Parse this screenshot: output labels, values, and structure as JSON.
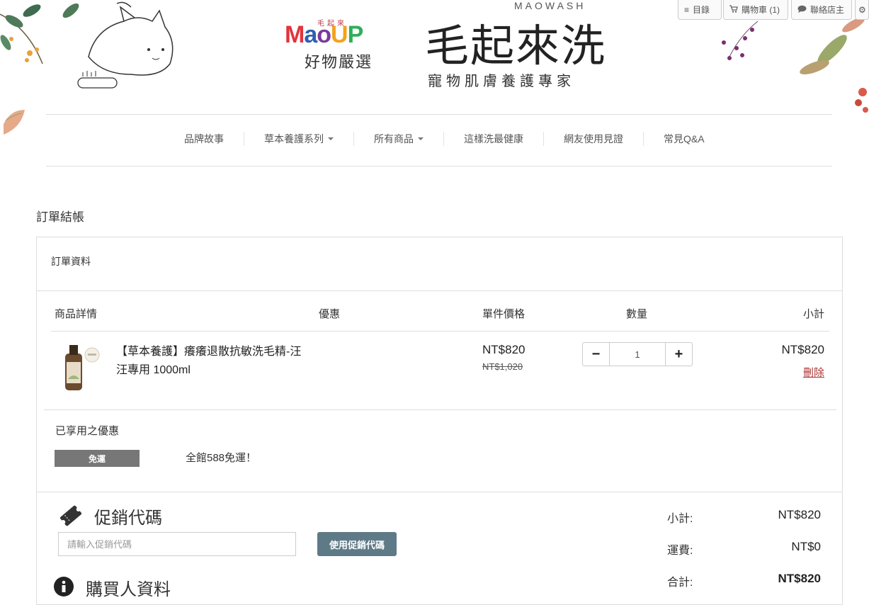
{
  "topbar": {
    "menu_label": "目錄",
    "cart_label": "購物車 (1)",
    "contact_label": "聯絡店主"
  },
  "header": {
    "maoup_small": "毛起來",
    "maoup_letters": [
      "M",
      "a",
      "o",
      "U",
      "P"
    ],
    "haowu": "好物嚴選",
    "brand_en": "MAOWASH",
    "brand_zh": "毛起來洗",
    "brand_sub": "寵物肌膚養護專家"
  },
  "nav": [
    {
      "label": "品牌故事",
      "dropdown": false
    },
    {
      "label": "草本養護系列",
      "dropdown": true
    },
    {
      "label": "所有商品",
      "dropdown": true
    },
    {
      "label": "這樣洗最健康",
      "dropdown": false
    },
    {
      "label": "網友使用見證",
      "dropdown": false
    },
    {
      "label": "常見Q&A",
      "dropdown": false
    }
  ],
  "page_title": "訂單結帳",
  "order": {
    "section_title": "訂單資料",
    "columns": {
      "details": "商品詳情",
      "discount": "優惠",
      "unit_price": "單件價格",
      "quantity": "數量",
      "subtotal": "小計"
    },
    "items": [
      {
        "name": "【草本養護】癢癢退散抗敏洗毛精-汪汪專用 1000ml",
        "price": "NT$820",
        "original_price": "NT$1,020",
        "quantity": "1",
        "subtotal": "NT$820",
        "delete_label": "刪除"
      }
    ],
    "applied_title": "已享用之優惠",
    "applied_badge": "免運",
    "applied_desc": "全館588免運！"
  },
  "promo": {
    "title": "促銷代碼",
    "placeholder": "請輸入促銷代碼",
    "button": "使用促銷代碼"
  },
  "buyer": {
    "title": "購買人資料"
  },
  "summary": {
    "subtotal_label": "小計:",
    "subtotal_value": "NT$820",
    "shipping_label": "運費:",
    "shipping_value": "NT$0",
    "total_label": "合計:",
    "total_value": "NT$820"
  },
  "colors": {
    "accent_button": "#5f7a87",
    "badge": "#777777",
    "delete_link": "#aa3333"
  }
}
